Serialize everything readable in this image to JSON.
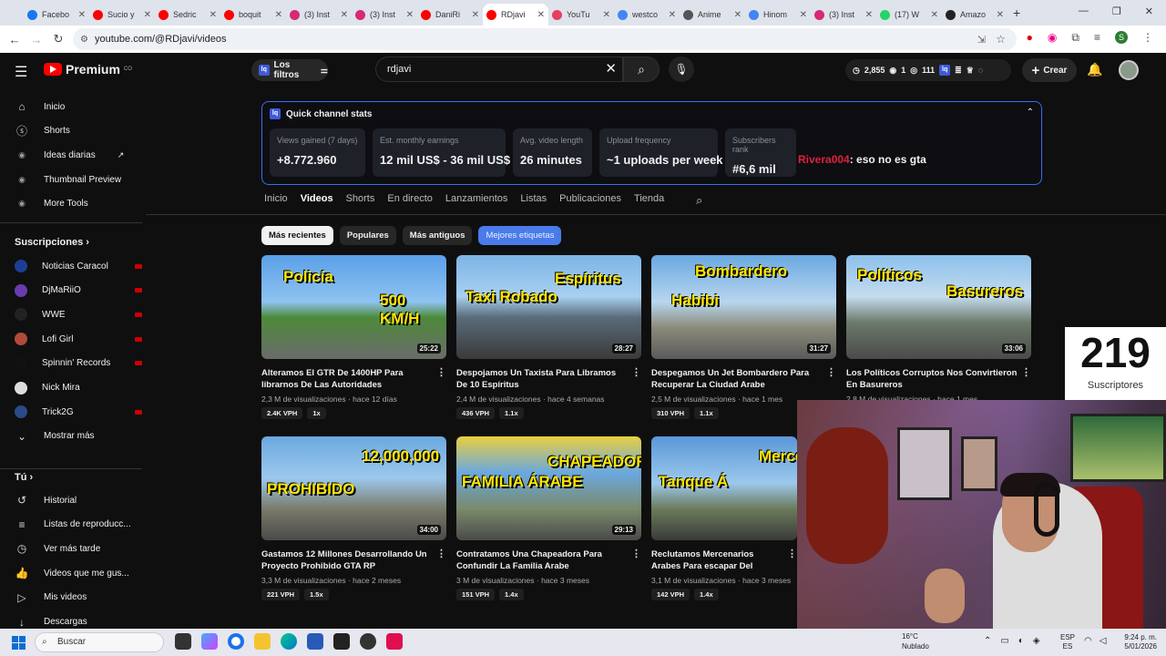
{
  "browser": {
    "tabs": [
      {
        "label": "Facebo",
        "color": "#1877f2"
      },
      {
        "label": "Sucio y",
        "color": "#ff0000"
      },
      {
        "label": "Sedric",
        "color": "#ff0000"
      },
      {
        "label": "boquit",
        "color": "#ff0000"
      },
      {
        "label": "(3) Inst",
        "color": "#d62976"
      },
      {
        "label": "(3) Inst",
        "color": "#d62976"
      },
      {
        "label": "DaniRi",
        "color": "#ff0000"
      },
      {
        "label": "RDjavi",
        "color": "#ff0000"
      },
      {
        "label": "YouTu",
        "color": "#e4405f"
      },
      {
        "label": "westco",
        "color": "#4285f4"
      },
      {
        "label": "Anime",
        "color": "#555555"
      },
      {
        "label": "Hinom",
        "color": "#4285f4"
      },
      {
        "label": "(3) Inst",
        "color": "#d62976"
      },
      {
        "label": "(17) W",
        "color": "#25d366"
      },
      {
        "label": "Amazo",
        "color": "#222222"
      }
    ],
    "active_tab": 7,
    "url": "youtube.com/@RDjavi/videos"
  },
  "masthead": {
    "logo_text": "Premium",
    "logo_sup": "CO",
    "filters_label": "Los filtros",
    "search_value": "rdjavi",
    "stats": {
      "views": "2,855",
      "eye": "1",
      "count": "111"
    },
    "create_label": "Crear"
  },
  "sidebar": {
    "main": [
      {
        "icon": "home-icon",
        "label": "Inicio"
      },
      {
        "icon": "shorts-icon",
        "label": "Shorts"
      },
      {
        "icon": "ext-icon",
        "label": "Ideas diarias"
      },
      {
        "icon": "ext-icon",
        "label": "Thumbnail Preview"
      },
      {
        "icon": "ext-icon",
        "label": "More Tools"
      }
    ],
    "subs_header": "Suscripciones",
    "subs": [
      {
        "label": "Noticias Caracol",
        "color": "#1c3f95"
      },
      {
        "label": "DjMaRiiO",
        "color": "#6a3ab0"
      },
      {
        "label": "WWE",
        "color": "#222222"
      },
      {
        "label": "Lofi Girl",
        "color": "#b04a3a"
      },
      {
        "label": "Spinnin' Records",
        "color": "#111111"
      },
      {
        "label": "Nick Mira",
        "color": "#dddddd"
      },
      {
        "label": "Trick2G",
        "color": "#2a4a8a"
      }
    ],
    "show_more": "Mostrar más",
    "you_header": "Tú",
    "you": [
      {
        "label": "Historial"
      },
      {
        "label": "Listas de reproducc..."
      },
      {
        "label": "Ver más tarde"
      },
      {
        "label": "Videos que me gus..."
      },
      {
        "label": "Mis videos"
      },
      {
        "label": "Descargas"
      }
    ]
  },
  "stats_panel": {
    "title": "Quick channel stats",
    "cards": [
      {
        "label": "Views gained (7 days)",
        "value": "+8.772.960"
      },
      {
        "label": "Est. monthly earnings",
        "value": "12 mil US$ - 36 mil US$"
      },
      {
        "label": "Avg. video length",
        "value": "26 minutes"
      },
      {
        "label": "Upload frequency",
        "value": "~1 uploads per week"
      },
      {
        "label": "Subscribers rank",
        "value": "#6,6 mil"
      }
    ],
    "chat_user": "Rivera004",
    "chat_text": ": eso no es gta"
  },
  "channel_tabs": [
    "Inicio",
    "Videos",
    "Shorts",
    "En directo",
    "Lanzamientos",
    "Listas",
    "Publicaciones",
    "Tienda"
  ],
  "chips": [
    "Más recientes",
    "Populares",
    "Más antiguos",
    "Mejores etiquetas"
  ],
  "videos": [
    {
      "t1": "Policía",
      "t2": "500 KM/H",
      "dur": "25:22",
      "title": "Alteramos El GTR De 1400HP Para librarnos De Las Autoridades",
      "meta": "2,3 M de visualizaciones · hace 12 días",
      "vph": "2.4K VPH",
      "mult": "1x",
      "bg": "linear-gradient(180deg,#5aa0e8 0%,#8fc3f0 45%,#4d8a3a 60%,#6b6b6b 100%)"
    },
    {
      "t1": "Taxi Robado",
      "t2": "Espíritus",
      "dur": "28:27",
      "title": "Despojamos Un Taxista Para Libramos De 10 Espíritus",
      "meta": "2,4 M de visualizaciones · hace 4 semanas",
      "vph": "436 VPH",
      "mult": "1.1x",
      "bg": "linear-gradient(180deg,#7db4e6 0%,#a8d0f0 40%,#5a6b7a 60%,#3a3a3a 100%)"
    },
    {
      "t1": "Bombardero",
      "t2": "Habibi",
      "dur": "31:27",
      "title": "Despegamos Un Jet Bombardero Para Recuperar La Ciudad Arabe",
      "meta": "2,5 M de visualizaciones · hace 1 mes",
      "vph": "310 VPH",
      "mult": "1.1x",
      "bg": "linear-gradient(180deg,#6aa8e0 0%,#b8d6ee 45%,#8a8a7a 70%,#5a5a5a 100%)"
    },
    {
      "t1": "Políticos",
      "t2": "Basureros",
      "dur": "33:06",
      "title": "Los Políticos Corruptos Nos Convirtieron En Basureros",
      "meta": "2,8 M de visualizaciones · hace 1 mes",
      "vph": "",
      "mult": "",
      "bg": "linear-gradient(180deg,#8cc0ec 0%,#c4dcee 40%,#6b7a6a 65%,#4a4a4a 100%)"
    },
    {
      "t1": "12,000,000",
      "t2": "PROHIBIDO",
      "dur": "34:00",
      "title": "Gastamos 12 Millones Desarrollando Un Proyecto Prohibido GTA RP",
      "meta": "3,3 M de visualizaciones · hace 2 meses",
      "vph": "221 VPH",
      "mult": "1.5x",
      "bg": "linear-gradient(180deg,#6aa8e0 0%,#9cc8ec 40%,#7a7a6a 70%,#4a4a4a 100%)"
    },
    {
      "t1": "FAMILIA ÁRABE",
      "t2": "CHAPEADORA",
      "dur": "29:13",
      "title": "Contratamos Una Chapeadora Para Confundir La Familia Arabe",
      "meta": "3 M de visualizaciones · hace 3 meses",
      "vph": "151 VPH",
      "mult": "1.4x",
      "bg": "linear-gradient(180deg,#e8d040 0%,#6aa8e0 35%,#7a8a6a 70%,#4a4a4a 100%)"
    },
    {
      "t1": "Mercenario",
      "t2": "Tanque Á",
      "dur": "",
      "title": "Reclutamos Mercenarios Arabes Para escapar Del Pasado",
      "meta": "3,1 M de visualizaciones · hace 3 meses",
      "vph": "142 VPH",
      "mult": "1.4x",
      "bg": "linear-gradient(180deg,#5a98d8 0%,#9cc8ec 45%,#6b7a5a 70%,#3a3a3a 100%)"
    }
  ],
  "overlay": {
    "subscribers": "219",
    "subscribers_label": "Suscriptores"
  },
  "taskbar": {
    "search": "Buscar",
    "temp": "16°C",
    "weather": "Nublado",
    "lang1": "ESP",
    "lang2": "ES",
    "time": "9:24 p. m.",
    "date": "5/01/2026"
  }
}
